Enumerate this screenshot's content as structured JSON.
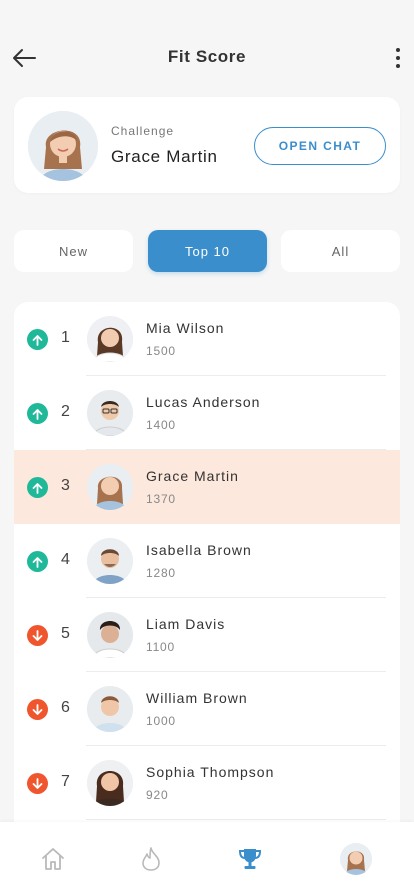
{
  "header": {
    "title": "Fit Score"
  },
  "challenge": {
    "label": "Challenge",
    "name": "Grace Martin",
    "button_label": "OPEN CHAT"
  },
  "tabs": [
    {
      "label": "New",
      "active": false
    },
    {
      "label": "Top 10",
      "active": true
    },
    {
      "label": "All",
      "active": false
    }
  ],
  "leaderboard": [
    {
      "rank": "1",
      "name": "Mia Wilson",
      "score": "1500",
      "trend": "up",
      "highlight": false
    },
    {
      "rank": "2",
      "name": "Lucas Anderson",
      "score": "1400",
      "trend": "up",
      "highlight": false
    },
    {
      "rank": "3",
      "name": "Grace Martin",
      "score": "1370",
      "trend": "up",
      "highlight": true
    },
    {
      "rank": "4",
      "name": "Isabella Brown",
      "score": "1280",
      "trend": "up",
      "highlight": false
    },
    {
      "rank": "5",
      "name": "Liam Davis",
      "score": "1100",
      "trend": "down",
      "highlight": false
    },
    {
      "rank": "6",
      "name": "William Brown",
      "score": "1000",
      "trend": "down",
      "highlight": false
    },
    {
      "rank": "7",
      "name": "Sophia Thompson",
      "score": "920",
      "trend": "down",
      "highlight": false
    }
  ],
  "bottom_nav": [
    {
      "icon": "home-icon",
      "active": false
    },
    {
      "icon": "flame-icon",
      "active": false
    },
    {
      "icon": "trophy-icon",
      "active": true
    },
    {
      "icon": "profile-avatar",
      "active": false
    }
  ],
  "colors": {
    "accent": "#3a8ecc",
    "up": "#1fb99a",
    "down": "#f0562e",
    "highlight": "#fce8dc",
    "background": "#f6f6f6"
  }
}
